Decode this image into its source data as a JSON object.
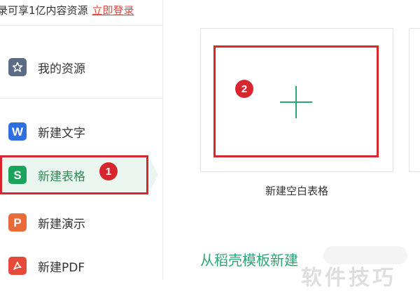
{
  "banner": {
    "prefix": "录可享1亿内容资源",
    "login_link": "立即登录"
  },
  "sidebar": {
    "items": [
      {
        "label": "我的资源",
        "icon": "star-icon"
      },
      {
        "label": "新建文字",
        "icon": "w-letter-icon",
        "glyph": "W"
      },
      {
        "label": "新建表格",
        "icon": "s-letter-icon",
        "glyph": "S",
        "active": true
      },
      {
        "label": "新建演示",
        "icon": "p-letter-icon",
        "glyph": "P"
      },
      {
        "label": "新建PDF",
        "icon": "pdf-icon"
      }
    ]
  },
  "main": {
    "blank_card_caption": "新建空白表格",
    "template_heading": "从稻壳模板新建"
  },
  "annotations": {
    "badge1": "1",
    "badge2": "2"
  },
  "watermark": "软件技巧",
  "colors": {
    "accent_green": "#2aa673",
    "annotation_red": "#d7262e",
    "login_red": "#e0483f",
    "active_bg": "#eaf6ef"
  }
}
